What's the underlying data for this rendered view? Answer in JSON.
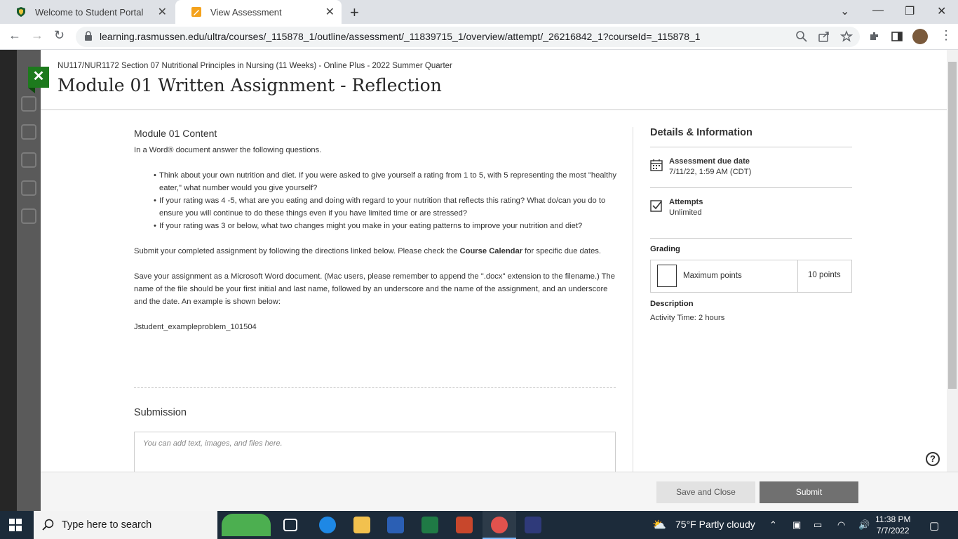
{
  "browser": {
    "tabs": [
      {
        "title": "Welcome to Student Portal",
        "active": false
      },
      {
        "title": "View Assessment",
        "active": true
      }
    ],
    "url": "learning.rasmussen.edu/ultra/courses/_115878_1/outline/assessment/_11839715_1/overview/attempt/_26216842_1?courseId=_115878_1"
  },
  "header": {
    "course": "NU117/NUR1172 Section 07 Nutritional Principles in Nursing (11 Weeks) - Online Plus - 2022 Summer Quarter",
    "title": "Module 01 Written Assignment - Reflection",
    "close_label": "✕"
  },
  "content": {
    "heading": "Module 01 Content",
    "intro": "In a Word® document answer the following questions.",
    "bullets": [
      "Think about your own nutrition and diet. If you were asked to give yourself a rating from 1 to 5, with 5 representing the most \"healthy eater,\" what number would you give yourself?",
      "If your rating was 4 -5, what are you eating and doing with regard to your nutrition that reflects this rating? What do/can you do to ensure you will continue to do these things even if you have limited time or are stressed?",
      "If your rating was 3 or below, what two changes might you make in your eating patterns to improve your nutrition and diet?"
    ],
    "submit_pre": "Submit your completed assignment by following the directions linked below. Please check the ",
    "submit_bold": "Course Calendar",
    "submit_post": " for specific due dates.",
    "save_instructions": "Save your assignment as a Microsoft Word document. (Mac users, please remember to append the \".docx\" extension to the filename.) The name of the file should be your first initial and last name, followed by an underscore and the name of the assignment, and an underscore and the date. An example is shown below:",
    "example": "Jstudent_exampleproblem_101504"
  },
  "submission": {
    "heading": "Submission",
    "placeholder": "You can add text, images, and files here."
  },
  "details": {
    "heading": "Details & Information",
    "due_label": "Assessment due date",
    "due_value": "7/11/22, 1:59 AM (CDT)",
    "attempts_label": "Attempts",
    "attempts_value": "Unlimited",
    "grading_label": "Grading",
    "max_points_label": "Maximum points",
    "max_points_value": "10 points",
    "description_label": "Description",
    "description_value": "Activity Time: 2 hours"
  },
  "footer": {
    "save_close": "Save and Close",
    "submit": "Submit"
  },
  "taskbar": {
    "search_placeholder": "Type here to search",
    "weather": "75°F  Partly cloudy",
    "time": "11:38 PM",
    "date": "7/7/2022"
  },
  "colors": {
    "accent_green": "#1d7a1d",
    "submit_gray": "#707070",
    "taskbar": "#1c2b3a"
  }
}
